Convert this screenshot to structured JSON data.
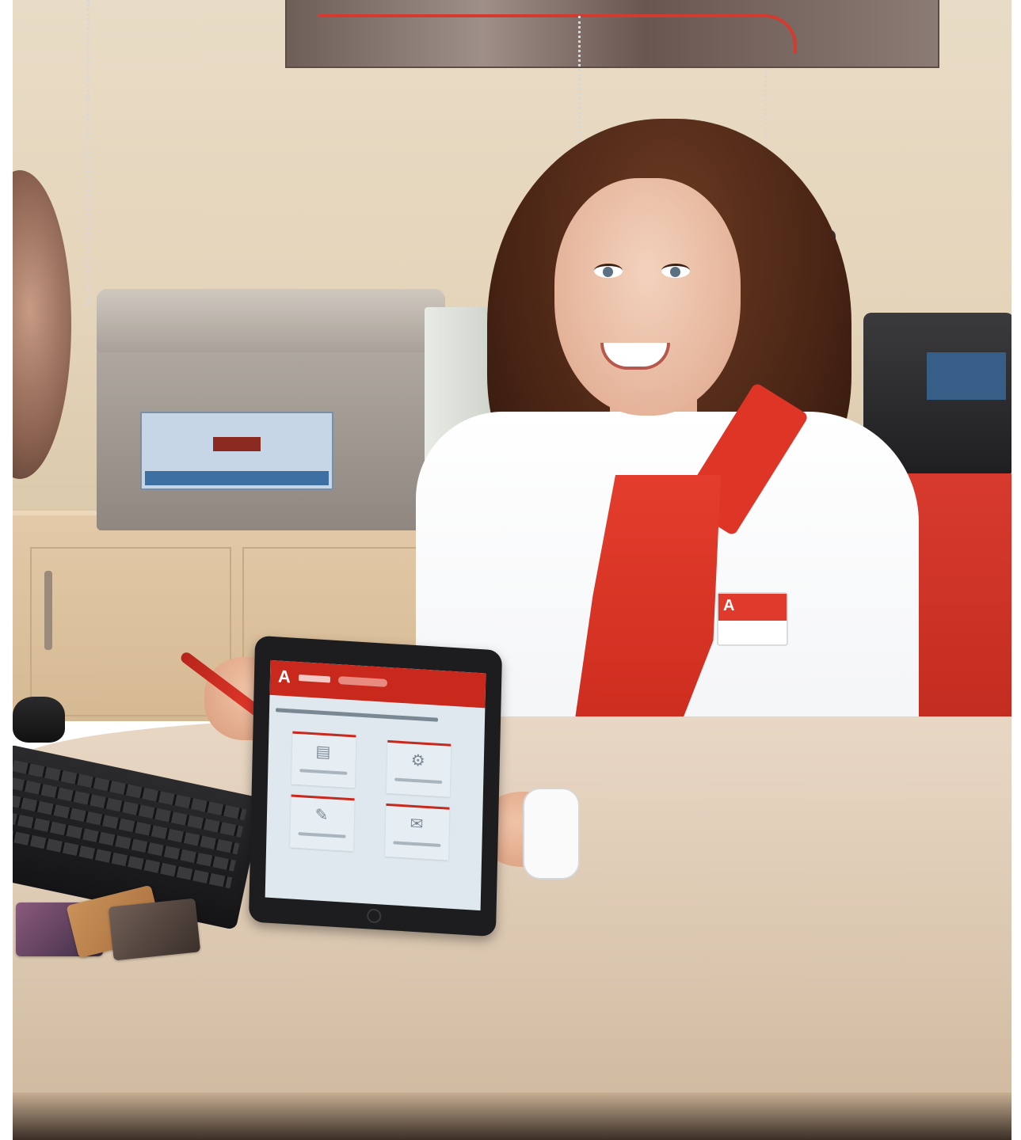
{
  "scene": {
    "palette": {
      "wall": "#e6d8c0",
      "desk": "#ddc9b2",
      "brand_red": "#d8362a",
      "shirt_white": "#f7f8fa",
      "chair_red": "#d0301f"
    }
  },
  "tablet": {
    "app": {
      "logo_glyph": "A",
      "header_color": "#c8291c",
      "tiles": [
        {
          "icon": "document-icon",
          "glyph": "▤"
        },
        {
          "icon": "gear-icon",
          "glyph": "⚙"
        },
        {
          "icon": "pencil-icon",
          "glyph": "✎"
        },
        {
          "icon": "envelope-icon",
          "glyph": "✉"
        }
      ]
    }
  },
  "badge": {
    "logo_glyph": "A"
  }
}
